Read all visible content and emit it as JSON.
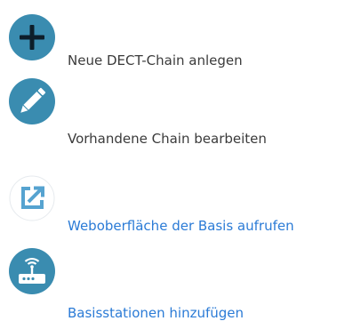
{
  "actions": [
    {
      "label": "Neue DECT-Chain anlegen",
      "icon": "plus-icon",
      "is_link": false
    },
    {
      "label": "Vorhandene Chain bearbeiten",
      "icon": "pencil-icon",
      "is_link": false
    },
    {
      "label": "Weboberfläche der Basis aufrufen",
      "icon": "external-link-icon",
      "is_link": true
    },
    {
      "label": "Basisstationen hinzufügen",
      "icon": "router-icon",
      "is_link": true
    }
  ],
  "colors": {
    "icon_circle": "#3a8cb0",
    "icon_glyph": "#ffffff",
    "text": "#3b3b3b",
    "link": "#2b7bd6",
    "external_icon": "#56a3d0"
  }
}
